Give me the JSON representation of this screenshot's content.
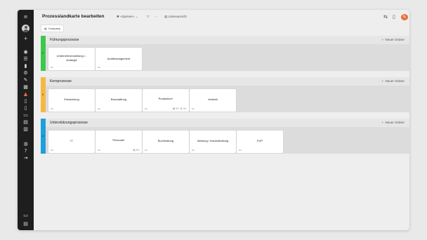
{
  "header": {
    "title": "Prozesslandkarte bearbeiten",
    "view_selector": "«Spinner»",
    "more_glyph": "···",
    "list_view_label": "Listenansicht"
  },
  "chip": {
    "label": "Company"
  },
  "section_new_label": "Neuer Ordner",
  "sections": [
    {
      "title": "Führungsprozesse",
      "marker": "F",
      "color": "#3cc94a",
      "cards": [
        {
          "label": "Unternehmensleitung / -strategie"
        },
        {
          "label": "Auditmanagement"
        }
      ]
    },
    {
      "title": "Kernprozesse",
      "marker": "K",
      "color": "#f5b942",
      "cards": [
        {
          "label": "Entwicklung"
        },
        {
          "label": "Beschaffung"
        },
        {
          "label": "Produktion*",
          "meta": "▤ 9+  ⚙ 3+"
        },
        {
          "label": "Vertrieb"
        }
      ]
    },
    {
      "title": "Unterstützungsprozesse",
      "marker": "U",
      "color": "#1ea0dc",
      "cards": [
        {
          "label": "IT"
        },
        {
          "label": "Personal*",
          "meta": "▤ 9+"
        },
        {
          "label": "Buchhaltung"
        },
        {
          "label": "Wartung / Instandhaltung"
        },
        {
          "label": "KVP"
        }
      ]
    }
  ]
}
